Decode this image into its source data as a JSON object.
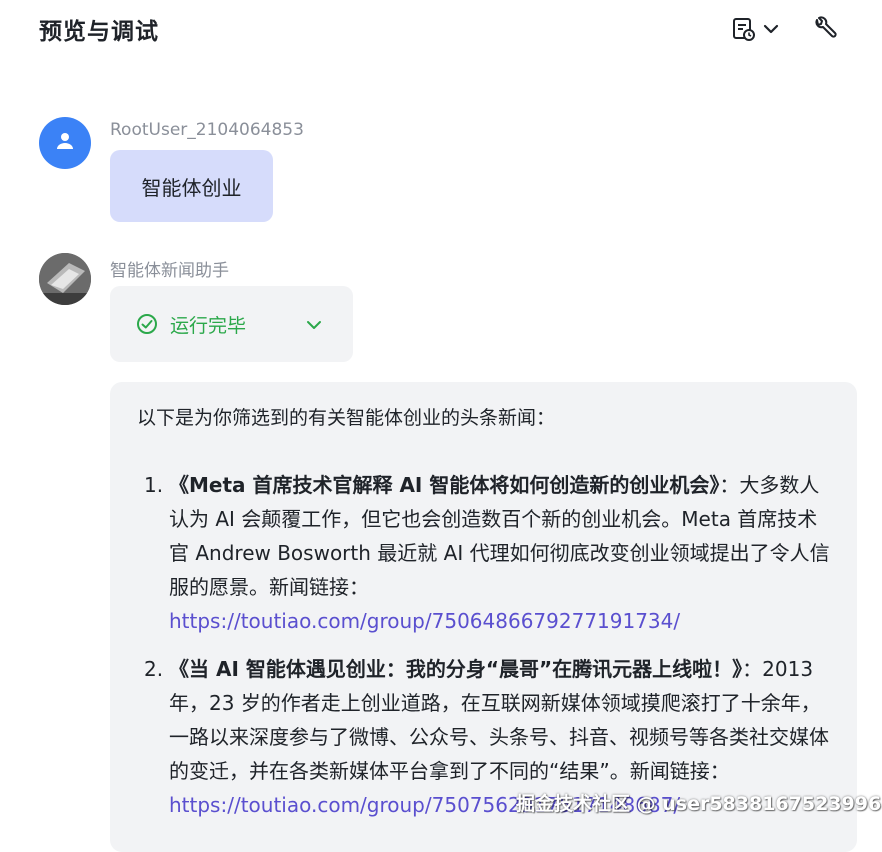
{
  "header": {
    "title": "预览与调试",
    "history_icon": "history-icon",
    "tool_icon": "wrench-icon"
  },
  "messages": {
    "user": {
      "name": "RootUser_2104064853",
      "text": "智能体创业",
      "avatar_color": "#3b82f6"
    },
    "agent": {
      "name": "智能体新闻助手",
      "status": "运行完毕",
      "status_color": "#2ba84a",
      "intro": "以下是为你筛选到的有关智能体创业的头条新闻：",
      "items": [
        {
          "num": "1.",
          "title": "《Meta 首席技术官解释 AI 智能体将如何创造新的创业机会》",
          "body": "：大多数人认为 AI 会颠覆工作，但它也会创造数百个新的创业机会。Meta 首席技术官 Andrew Bosworth 最近就 AI 代理如何彻底改变创业领域提出了令人信服的愿景。新闻链接：",
          "link": "https://toutiao.com/group/7506486679277191734/"
        },
        {
          "num": "2.",
          "title": "《当 AI 智能体遇见创业：我的分身“晨哥”在腾讯元器上线啦！》",
          "body": "：2013 年，23 岁的作者走上创业道路，在互联网新媒体领域摸爬滚打了十余年，一路以来深度参与了微博、公众号、头条号、抖音、视频号等各类社交媒体的变迁，并在各类新媒体平台拿到了不同的“结果”。新闻链接：",
          "link": "https://toutiao.com/group/7507562917517148687/"
        }
      ]
    }
  },
  "watermark": "掘金技术社区 @ user5838167523996",
  "colors": {
    "accent_link": "#5a4fcf",
    "bubble_user": "#d6dcfb",
    "card_bg": "#f2f3f5"
  }
}
